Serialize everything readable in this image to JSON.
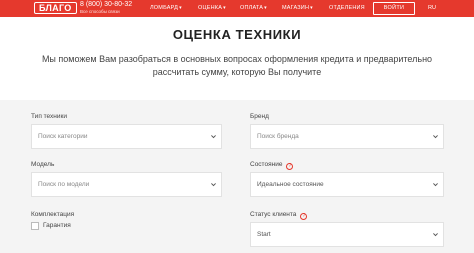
{
  "header": {
    "logo": "БЛАГО",
    "phone": "8 (800) 30-80-32",
    "phone_note": "Все способы связи",
    "nav": [
      {
        "label": "ЛОМБАРД",
        "has_dropdown": true
      },
      {
        "label": "ОЦЕНКА",
        "has_dropdown": true
      },
      {
        "label": "ОПЛАТА",
        "has_dropdown": true
      },
      {
        "label": "МАГАЗИН",
        "has_dropdown": true
      },
      {
        "label": "ОТДЕЛЕНИЯ",
        "has_dropdown": false
      }
    ],
    "login": "ВОЙТИ",
    "lang": "RU"
  },
  "page": {
    "title": "ОЦЕНКА ТЕХНИКИ",
    "description": "Мы поможем Вам разобраться в основных вопросах оформления кредита и предварительно рассчитать сумму, которую Вы получите"
  },
  "form": {
    "type": {
      "label": "Тип техники",
      "placeholder": "Поиск категории"
    },
    "brand": {
      "label": "Бренд",
      "placeholder": "Поиск бренда"
    },
    "model": {
      "label": "Модель",
      "placeholder": "Поиск по модели"
    },
    "condition": {
      "label": "Состояние",
      "value": "Идеальное состояние"
    },
    "kit": {
      "label": "Комплектация",
      "checkbox_label": "Гарантия"
    },
    "client_status": {
      "label": "Статус клиента",
      "value": "Start"
    }
  },
  "colors": {
    "brand_red": "#e5392d",
    "form_background": "#f4f4f4"
  }
}
